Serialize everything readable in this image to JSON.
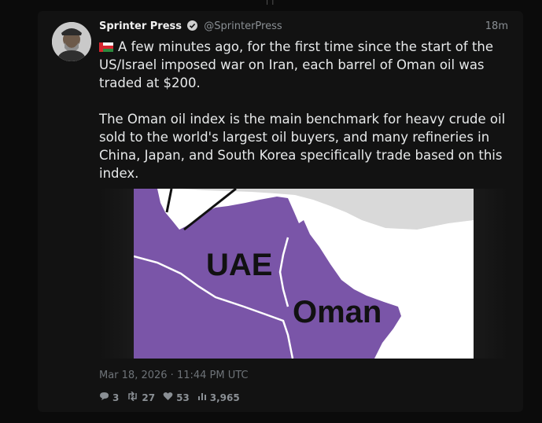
{
  "tweet": {
    "display_name": "Sprinter Press",
    "handle": "@SprinterPress",
    "time_ago": "18m",
    "paragraph1": "A few minutes ago, for the first time since the start of the US/Israel imposed war on Iran, each barrel of Oman oil was traded at $200.",
    "paragraph2": "The Oman oil index is the main benchmark for heavy crude oil sold to the world's largest oil buyers, and many refineries in China, Japan, and South Korea specifically trade based on this index.",
    "timestamp": "Mar 18, 2026 · 11:44 PM UTC"
  },
  "map": {
    "label_uae": "UAE",
    "label_oman": "Oman",
    "highlight_color": "#7a55a8",
    "land_color": "#d9d9d9",
    "sea_color": "#ffffff"
  },
  "stats": {
    "replies": "3",
    "retweets": "27",
    "likes": "53",
    "views": "3,965"
  },
  "icons": [
    "verified-icon",
    "oman-flag-icon",
    "reply-icon",
    "retweet-icon",
    "like-icon",
    "views-icon"
  ]
}
